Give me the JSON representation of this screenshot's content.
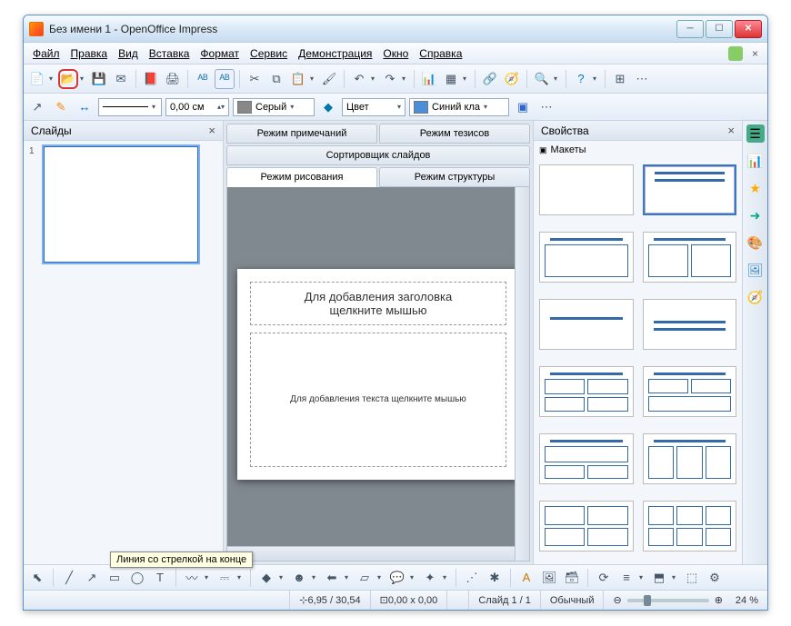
{
  "title": "Без имени 1 - OpenOffice Impress",
  "menu": [
    "Файл",
    "Правка",
    "Вид",
    "Вставка",
    "Формат",
    "Сервис",
    "Демонстрация",
    "Окно",
    "Справка"
  ],
  "toolbar2": {
    "line_width": "0,00 см",
    "fill_color_label": "Серый",
    "fill_mode_label": "Цвет",
    "line_color_label": "Синий кла"
  },
  "panels": {
    "slides_title": "Слайды",
    "props_title": "Свойства",
    "layouts_title": "Макеты"
  },
  "tabs": {
    "notes": "Режим примечаний",
    "handout": "Режим тезисов",
    "sorter": "Сортировщик слайдов",
    "drawing": "Режим рисования",
    "outline": "Режим структуры"
  },
  "slide": {
    "title_placeholder_l1": "Для добавления заголовка",
    "title_placeholder_l2": "щелкните мышью",
    "body_placeholder": "Для добавления текста щелкните мышью"
  },
  "tooltip": "Линия со стрелкой на конце",
  "status": {
    "coords": "6,95 / 30,54",
    "size": "0,00 x 0,00",
    "slide": "Слайд 1 / 1",
    "layout": "Обычный",
    "zoom": "24 %"
  },
  "slide_number": "1"
}
